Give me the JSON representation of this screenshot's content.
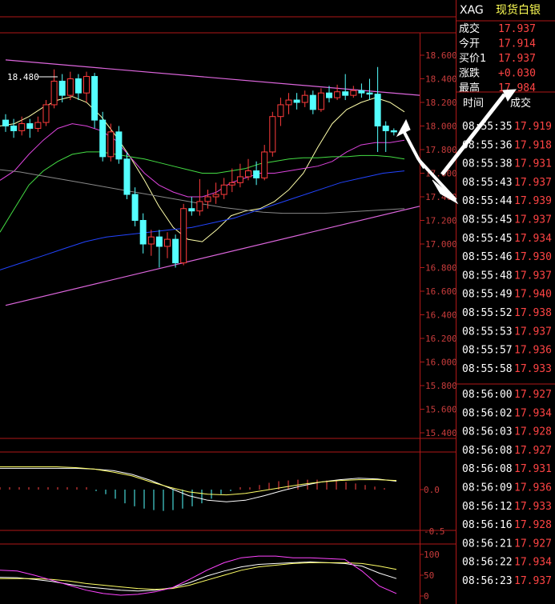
{
  "quote_panel": {
    "symbol": "XAG",
    "name": "现货白银",
    "rows": [
      {
        "label": "成交",
        "value": "17.937"
      },
      {
        "label": "今开",
        "value": "17.914"
      },
      {
        "label": "买价1",
        "value": "17.937"
      },
      {
        "label": "涨跌",
        "value": "+0.030"
      },
      {
        "label": "最高",
        "value": "17.984"
      }
    ],
    "trades_header": {
      "time": "时间",
      "price": "成交"
    },
    "trades": [
      {
        "time": "08:55:35",
        "price": "17.919"
      },
      {
        "time": "08:55:36",
        "price": "17.918"
      },
      {
        "time": "08:55:38",
        "price": "17.931"
      },
      {
        "time": "08:55:43",
        "price": "17.937"
      },
      {
        "time": "08:55:44",
        "price": "17.939"
      },
      {
        "time": "08:55:45",
        "price": "17.937"
      },
      {
        "time": "08:55:45",
        "price": "17.934"
      },
      {
        "time": "08:55:46",
        "price": "17.930"
      },
      {
        "time": "08:55:48",
        "price": "17.937"
      },
      {
        "time": "08:55:49",
        "price": "17.940"
      },
      {
        "time": "08:55:52",
        "price": "17.938"
      },
      {
        "time": "08:55:53",
        "price": "17.937"
      },
      {
        "time": "08:55:57",
        "price": "17.936"
      },
      {
        "time": "08:55:58",
        "price": "17.933"
      },
      {
        "time": "08:56:00",
        "price": "17.927"
      },
      {
        "time": "08:56:02",
        "price": "17.934"
      },
      {
        "time": "08:56:03",
        "price": "17.928"
      },
      {
        "time": "08:56:08",
        "price": "17.927"
      },
      {
        "time": "08:56:08",
        "price": "17.931"
      },
      {
        "time": "08:56:09",
        "price": "17.936"
      },
      {
        "time": "08:56:12",
        "price": "17.933"
      },
      {
        "time": "08:56:16",
        "price": "17.928"
      },
      {
        "time": "08:56:21",
        "price": "17.927"
      },
      {
        "time": "08:56:22",
        "price": "17.934"
      },
      {
        "time": "08:56:23",
        "price": "17.937"
      }
    ]
  },
  "chart_data": [
    {
      "type": "candlestick",
      "high_label": "18.480",
      "ylim": [
        15.4,
        18.7
      ],
      "yticks": [
        18.6,
        18.4,
        18.2,
        18.0,
        17.8,
        17.6,
        17.4,
        17.2,
        17.0,
        16.8,
        16.6,
        16.4,
        16.2,
        16.0,
        15.8,
        15.6,
        15.4
      ],
      "ytick_labels": [
        "18.600",
        "18.400",
        "18.200",
        "18.000",
        "17.800",
        "17.600",
        "17.400",
        "17.200",
        "17.000",
        "16.800",
        "16.600",
        "16.400",
        "16.200",
        "16.000",
        "15.800",
        "15.600",
        "15.400"
      ],
      "candles": [
        [
          18.05,
          18.0,
          18.1,
          17.95
        ],
        [
          18.0,
          17.96,
          18.06,
          17.9
        ],
        [
          17.96,
          18.02,
          18.08,
          17.92
        ],
        [
          18.02,
          17.98,
          18.06,
          17.9
        ],
        [
          17.98,
          18.03,
          18.08,
          17.95
        ],
        [
          18.03,
          18.18,
          18.22,
          18.0
        ],
        [
          18.18,
          18.38,
          18.48,
          18.15
        ],
        [
          18.38,
          18.26,
          18.44,
          18.2
        ],
        [
          18.26,
          18.4,
          18.46,
          18.22
        ],
        [
          18.4,
          18.28,
          18.44,
          18.22
        ],
        [
          18.28,
          18.42,
          18.46,
          18.2
        ],
        [
          18.42,
          18.05,
          18.45,
          17.98
        ],
        [
          18.05,
          17.74,
          18.12,
          17.7
        ],
        [
          17.74,
          17.95,
          18.02,
          17.7
        ],
        [
          17.95,
          17.72,
          18.0,
          17.68
        ],
        [
          17.72,
          17.42,
          17.78,
          17.38
        ],
        [
          17.42,
          17.2,
          17.48,
          17.15
        ],
        [
          17.2,
          17.0,
          17.26,
          16.92
        ],
        [
          17.0,
          17.06,
          17.12,
          16.9
        ],
        [
          17.06,
          16.98,
          17.12,
          16.8
        ],
        [
          16.98,
          17.04,
          17.1,
          16.88
        ],
        [
          17.04,
          16.84,
          17.08,
          16.8
        ],
        [
          16.84,
          17.3,
          17.34,
          16.82
        ],
        [
          17.3,
          17.28,
          17.4,
          17.24
        ],
        [
          17.28,
          17.36,
          17.55,
          17.24
        ],
        [
          17.36,
          17.4,
          17.46,
          17.3
        ],
        [
          17.4,
          17.42,
          17.52,
          17.34
        ],
        [
          17.42,
          17.5,
          17.56,
          17.38
        ],
        [
          17.5,
          17.52,
          17.64,
          17.44
        ],
        [
          17.52,
          17.57,
          17.68,
          17.48
        ],
        [
          17.57,
          17.62,
          17.72,
          17.54
        ],
        [
          17.62,
          17.56,
          17.7,
          17.5
        ],
        [
          17.56,
          17.78,
          17.84,
          17.54
        ],
        [
          17.78,
          18.08,
          18.12,
          17.74
        ],
        [
          18.08,
          18.18,
          18.24,
          18.0
        ],
        [
          18.18,
          18.22,
          18.28,
          18.1
        ],
        [
          18.22,
          18.2,
          18.28,
          18.14
        ],
        [
          18.2,
          18.26,
          18.3,
          18.16
        ],
        [
          18.26,
          18.14,
          18.3,
          18.1
        ],
        [
          18.14,
          18.28,
          18.32,
          18.12
        ],
        [
          18.28,
          18.24,
          18.34,
          18.2
        ],
        [
          18.24,
          18.29,
          18.35,
          18.22
        ],
        [
          18.29,
          18.26,
          18.44,
          18.22
        ],
        [
          18.26,
          18.3,
          18.34,
          18.24
        ],
        [
          18.3,
          18.28,
          18.36,
          18.24
        ],
        [
          18.28,
          18.27,
          18.4,
          18.22
        ],
        [
          18.27,
          18.0,
          18.5,
          17.78
        ],
        [
          18.0,
          17.96,
          18.04,
          17.78
        ],
        [
          17.96,
          17.95,
          17.98,
          17.92
        ]
      ],
      "ma_lines": [
        {
          "color": "#ffffaa",
          "values": [
            18.0,
            18.02,
            18.08,
            18.16,
            18.22,
            18.25,
            18.2,
            18.08,
            17.92,
            17.74,
            17.54,
            17.32,
            17.14,
            17.04,
            17.02,
            17.12,
            17.24,
            17.28,
            17.3,
            17.36,
            17.46,
            17.6,
            17.82,
            18.02,
            18.14,
            18.2,
            18.24,
            18.2,
            18.12
          ]
        },
        {
          "color": "#dd44dd",
          "values": [
            17.54,
            17.62,
            17.76,
            17.88,
            17.98,
            18.02,
            18.0,
            17.96,
            17.88,
            17.74,
            17.6,
            17.5,
            17.44,
            17.4,
            17.4,
            17.44,
            17.52,
            17.56,
            17.6,
            17.6,
            17.62,
            17.64,
            17.66,
            17.7,
            17.78,
            17.84,
            17.86,
            17.86,
            17.88
          ]
        },
        {
          "color": "#44dd44",
          "values": [
            17.1,
            17.3,
            17.5,
            17.62,
            17.7,
            17.76,
            17.78,
            17.78,
            17.76,
            17.74,
            17.72,
            17.69,
            17.66,
            17.63,
            17.6,
            17.6,
            17.62,
            17.64,
            17.68,
            17.7,
            17.72,
            17.73,
            17.73,
            17.74,
            17.74,
            17.75,
            17.75,
            17.74,
            17.72
          ]
        },
        {
          "color": "#888888",
          "values": [
            17.63,
            17.61,
            17.58,
            17.55,
            17.52,
            17.49,
            17.46,
            17.43,
            17.4,
            17.37,
            17.34,
            17.31,
            17.29,
            17.27,
            17.26,
            17.26,
            17.26,
            17.27,
            17.28,
            17.29,
            17.3
          ]
        },
        {
          "color": "#2244ff",
          "values": [
            16.78,
            16.84,
            16.9,
            16.96,
            17.02,
            17.06,
            17.08,
            17.1,
            17.12,
            17.14,
            17.18,
            17.22,
            17.28,
            17.34,
            17.4,
            17.46,
            17.52,
            17.56,
            17.6,
            17.62
          ]
        }
      ],
      "trendlines": [
        {
          "color": "#dd66dd",
          "from": [
            0,
            18.56
          ],
          "to": [
            48,
            18.26
          ]
        },
        {
          "color": "#dd66dd",
          "from": [
            0,
            16.48
          ],
          "to": [
            48,
            17.32
          ]
        }
      ]
    },
    {
      "type": "bar",
      "name": "macd",
      "ylim": [
        -0.5,
        0.5
      ],
      "ytick_labels": [
        "0.0",
        "-0.5"
      ],
      "values": [
        0,
        0,
        0,
        0,
        0,
        0,
        0,
        0,
        0,
        0,
        -0.02,
        -0.06,
        -0.12,
        -0.18,
        -0.22,
        -0.25,
        -0.27,
        -0.28,
        -0.27,
        -0.25,
        -0.22,
        -0.18,
        -0.12,
        -0.06,
        -0.02,
        0.0,
        0.03,
        0.06,
        0.09,
        0.11,
        0.12,
        0.13,
        0.13,
        0.13,
        0.12,
        0.11,
        0.1,
        0.08,
        0.06,
        0.04,
        0.02
      ],
      "dif": [
        0.28,
        0.28,
        0.28,
        0.28,
        0.28,
        0.27,
        0.25,
        0.2,
        0.12,
        0.02,
        -0.08,
        -0.14,
        -0.16,
        -0.14,
        -0.08,
        -0.01,
        0.05,
        0.1,
        0.13,
        0.15,
        0.14,
        0.11
      ],
      "dea": [
        0.3,
        0.3,
        0.3,
        0.3,
        0.29,
        0.27,
        0.23,
        0.18,
        0.1,
        0.03,
        -0.03,
        -0.06,
        -0.07,
        -0.05,
        -0.01,
        0.03,
        0.07,
        0.1,
        0.12,
        0.13,
        0.13,
        0.12
      ]
    },
    {
      "type": "line",
      "name": "kdj",
      "ylim": [
        0,
        100
      ],
      "ytick_labels": [
        "100",
        "50",
        "0"
      ],
      "series": [
        {
          "color": "#ffffff",
          "values": [
            45,
            44,
            40,
            35,
            28,
            22,
            18,
            14,
            12,
            14,
            20,
            32,
            48,
            60,
            70,
            76,
            78,
            80,
            82,
            80,
            78,
            72,
            55,
            42
          ]
        },
        {
          "color": "#ffff66",
          "values": [
            42,
            42,
            42,
            40,
            36,
            30,
            26,
            22,
            18,
            16,
            18,
            26,
            38,
            50,
            62,
            70,
            74,
            78,
            80,
            80,
            80,
            78,
            72,
            64
          ]
        },
        {
          "color": "#ff44ff",
          "values": [
            62,
            60,
            50,
            38,
            26,
            14,
            6,
            2,
            4,
            10,
            20,
            40,
            62,
            80,
            92,
            96,
            96,
            92,
            92,
            90,
            88,
            60,
            24,
            6
          ]
        }
      ]
    }
  ]
}
